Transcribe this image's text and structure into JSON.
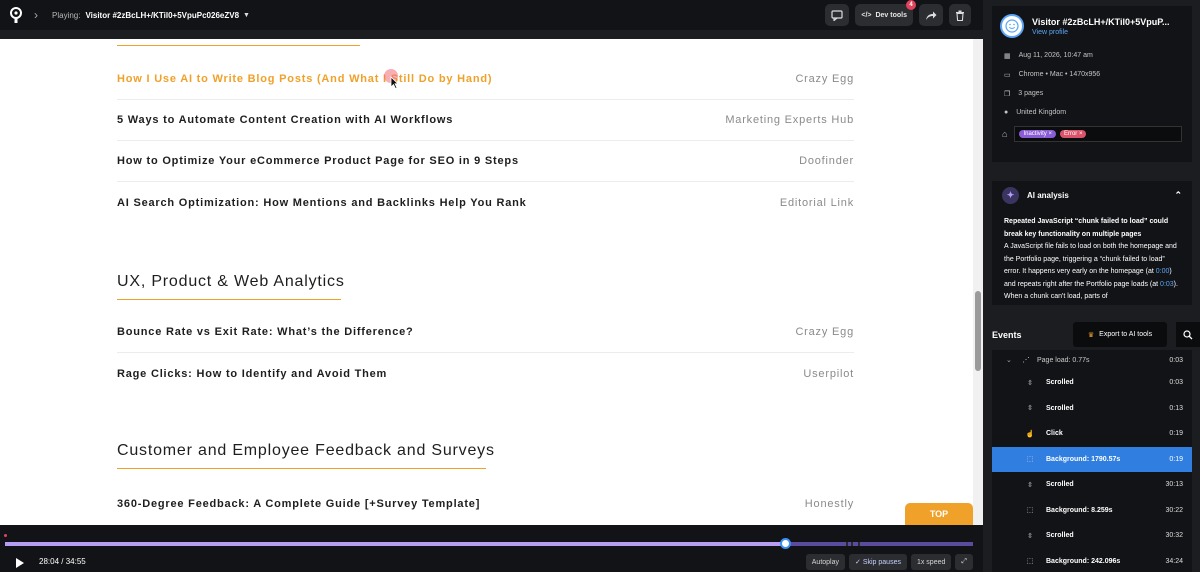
{
  "topbar": {
    "playing_label": "Playing:",
    "visitor_id": "Visitor #2zBcLH+/KTil0+5VpuPc026eZV8",
    "dev_tools_label": "Dev tools",
    "dev_tools_badge": "4"
  },
  "page": {
    "rows_top": [
      {
        "title": "How I Use AI to Write Blog Posts (And What I Still Do by Hand)",
        "source": "Crazy Egg",
        "highlight": true
      },
      {
        "title": "5 Ways to Automate Content Creation with AI Workflows",
        "source": "Marketing Experts Hub"
      },
      {
        "title": "How to Optimize Your eCommerce Product Page for SEO in 9 Steps",
        "source": "Doofinder"
      },
      {
        "title": "AI Search Optimization: How Mentions and Backlinks Help You Rank",
        "source": "Editorial Link"
      }
    ],
    "section_ux": "UX, Product & Web Analytics",
    "rows_ux": [
      {
        "title": "Bounce Rate vs Exit Rate: What’s the Difference?",
        "source": "Crazy Egg"
      },
      {
        "title": "Rage Clicks: How to Identify and Avoid Them",
        "source": "Userpilot"
      }
    ],
    "section_feedback": "Customer and Employee Feedback and Surveys",
    "rows_feedback": [
      {
        "title": "360-Degree Feedback: A Complete Guide [+Survey Template]",
        "source": "Honestly"
      }
    ],
    "top_button": "TOP"
  },
  "player": {
    "current_time": "28:04",
    "total_time": "34:55",
    "progress": 0.807,
    "autoplay_label": "Autoplay",
    "skip_pauses_label": "Skip pauses",
    "speed_label": "1x speed"
  },
  "visitor": {
    "name": "Visitor #2zBcLH+/KTil0+5VpuP...",
    "profile_link": "View profile",
    "date": "Aug 11, 2026, 10:47 am",
    "device": "Chrome • Mac • 1470x956",
    "pages": "3 pages",
    "location": "United Kingdom",
    "tags": [
      {
        "label": "Inactivity",
        "color": "#8a5cd6"
      },
      {
        "label": "Error",
        "color": "#d9536a"
      }
    ]
  },
  "ai": {
    "title": "AI analysis",
    "headline": "Repeated JavaScript “chunk failed to load” could break key functionality on multiple pages",
    "body_1": "A JavaScript file fails to load on both the homepage and the Portfolio page, triggering a “chunk failed to load” error. It happens very early on the homepage (at ",
    "ts_1": "0:00",
    "body_2": ") and repeats right after the Portfolio page loads (at ",
    "ts_2": "0:03",
    "body_3": "). When a chunk can't load, parts of"
  },
  "events": {
    "title": "Events",
    "export_label": "Export to AI tools",
    "items": [
      {
        "label": "Page load: 0.77s",
        "time": "0:03",
        "icon": "page-load",
        "kind": "page"
      },
      {
        "label": "Scrolled",
        "time": "0:03",
        "icon": "scroll"
      },
      {
        "label": "Scrolled",
        "time": "0:13",
        "icon": "scroll"
      },
      {
        "label": "Click",
        "time": "0:19",
        "icon": "click"
      },
      {
        "label": "Background: 1790.57s",
        "time": "0:19",
        "icon": "background",
        "selected": true
      },
      {
        "label": "Scrolled",
        "time": "30:13",
        "icon": "scroll"
      },
      {
        "label": "Background: 8.259s",
        "time": "30:22",
        "icon": "background"
      },
      {
        "label": "Scrolled",
        "time": "30:32",
        "icon": "scroll"
      },
      {
        "label": "Background: 242.096s",
        "time": "34:24",
        "icon": "background"
      }
    ]
  }
}
